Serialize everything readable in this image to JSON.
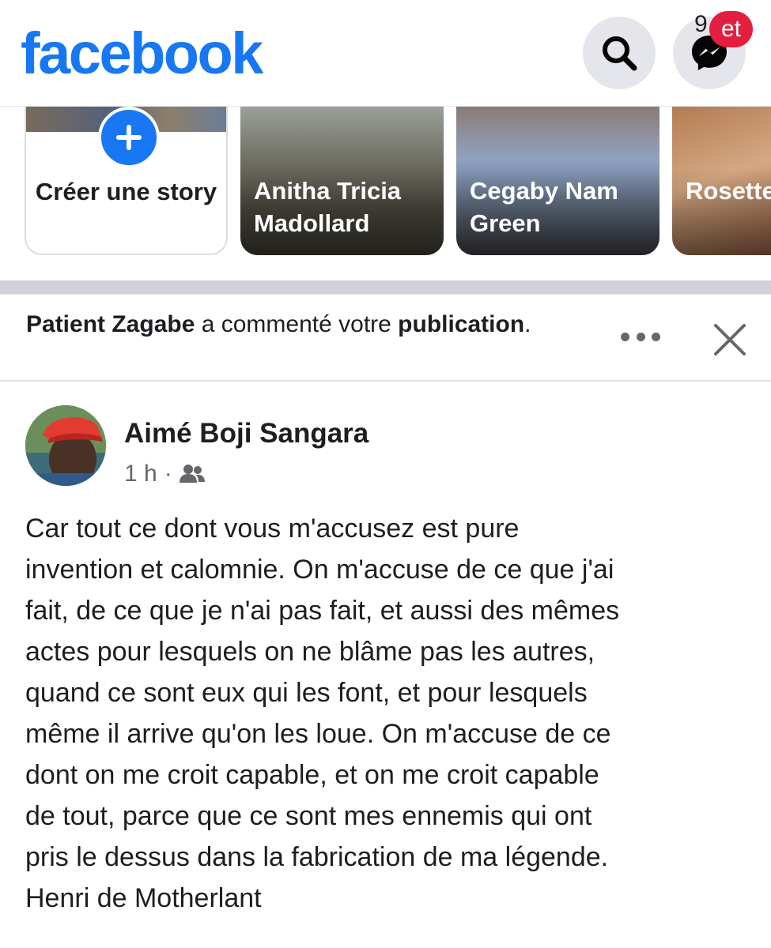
{
  "header": {
    "logo_text": "facebook",
    "search_icon": "search-icon",
    "messenger_icon": "messenger-icon",
    "messenger_badge_prefix": "9",
    "messenger_badge": "et",
    "brand_color": "#1877f2",
    "badge_color": "#e41e3f"
  },
  "stories": {
    "create_label": "Créer une story",
    "items": [
      {
        "name": "Anitha Tricia Madollard"
      },
      {
        "name": "Cegaby Nam Green"
      },
      {
        "name": "Rosette"
      }
    ]
  },
  "notification": {
    "actor": "Patient Zagabe",
    "text": " a commenté votre ",
    "object": "publication",
    "end": "."
  },
  "post": {
    "author": "Aimé Boji Sangara",
    "time": "1 h",
    "separator": "·",
    "audience_icon": "friends-icon",
    "body": "Car tout ce dont vous m'accusez est pure\ninvention et calomnie. On m'accuse de ce que j'ai\nfait, de ce que je n'ai pas fait, et aussi des mêmes\nactes pour lesquels on ne blâme pas les autres,\nquand ce sont eux qui les font, et pour lesquels\nmême il arrive qu'on les loue. On m'accuse de ce\ndont on me croit capable, et on me croit capable\nde tout, parce que ce sont mes ennemis qui ont\npris le dessus dans la fabrication de ma légende.\nHenri de Motherlant"
  }
}
